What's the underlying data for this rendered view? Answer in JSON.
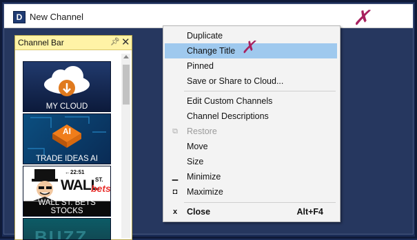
{
  "window": {
    "title": "New Channel",
    "app_icon_letter": "D"
  },
  "sidebar": {
    "title": "Channel Bar",
    "tiles": [
      {
        "label": "MY CLOUD"
      },
      {
        "label": "TRADE IDEAS AI",
        "badge": "AI"
      },
      {
        "label": "WALL ST. BETS STOCKS",
        "art_text": "WALL",
        "art_small": "ST.",
        "art_script": "bets",
        "art_ticker": "←22:51"
      },
      {
        "label": ""
      }
    ]
  },
  "menu": {
    "items": [
      {
        "label": "Duplicate"
      },
      {
        "label": "Change Title",
        "state": "highlighted"
      },
      {
        "label": "Pinned"
      },
      {
        "label": "Save or Share to Cloud..."
      },
      {
        "label": "Edit Custom Channels"
      },
      {
        "label": "Channel Descriptions"
      },
      {
        "label": "Restore",
        "state": "disabled",
        "icon": "restore-icon"
      },
      {
        "label": "Move"
      },
      {
        "label": "Size"
      },
      {
        "label": "Minimize",
        "icon": "minimize-icon"
      },
      {
        "label": "Maximize",
        "icon": "maximize-icon"
      },
      {
        "label": "Close",
        "shortcut": "Alt+F4",
        "icon": "close-icon"
      }
    ]
  },
  "annotations": {
    "mark_color": "#a8215f"
  },
  "colors": {
    "highlight": "#9fc9ee",
    "background": "#1b2c57",
    "sidebar_header": "#fff3a6"
  }
}
